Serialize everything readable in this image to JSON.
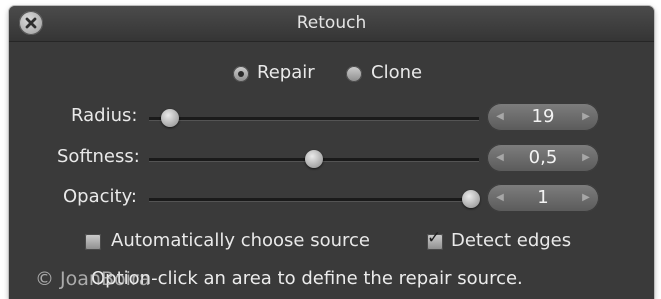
{
  "window": {
    "title": "Retouch"
  },
  "mode": {
    "options": [
      {
        "label": "Repair",
        "selected": true
      },
      {
        "label": "Clone",
        "selected": false
      }
    ]
  },
  "sliders": {
    "radius": {
      "label": "Radius:",
      "value": "19",
      "level": 0.04
    },
    "softness": {
      "label": "Softness:",
      "value": "0,5",
      "level": 0.5
    },
    "opacity": {
      "label": "Opacity:",
      "value": "1",
      "level": 1.0
    }
  },
  "options": {
    "auto_source": {
      "label": "Automatically choose source",
      "checked": false
    },
    "detect_edges": {
      "label": "Detect edges",
      "checked": true
    }
  },
  "hint": "Option-click an area to define the repair source.",
  "watermark": "© JoanBoira",
  "icons": {
    "close": "close-icon",
    "step_left": "chevron-left-icon",
    "step_right": "chevron-right-icon",
    "check": "checkmark-icon"
  },
  "colors": {
    "panel_bg": "#3a3a3a",
    "text": "#e9e9e9"
  }
}
